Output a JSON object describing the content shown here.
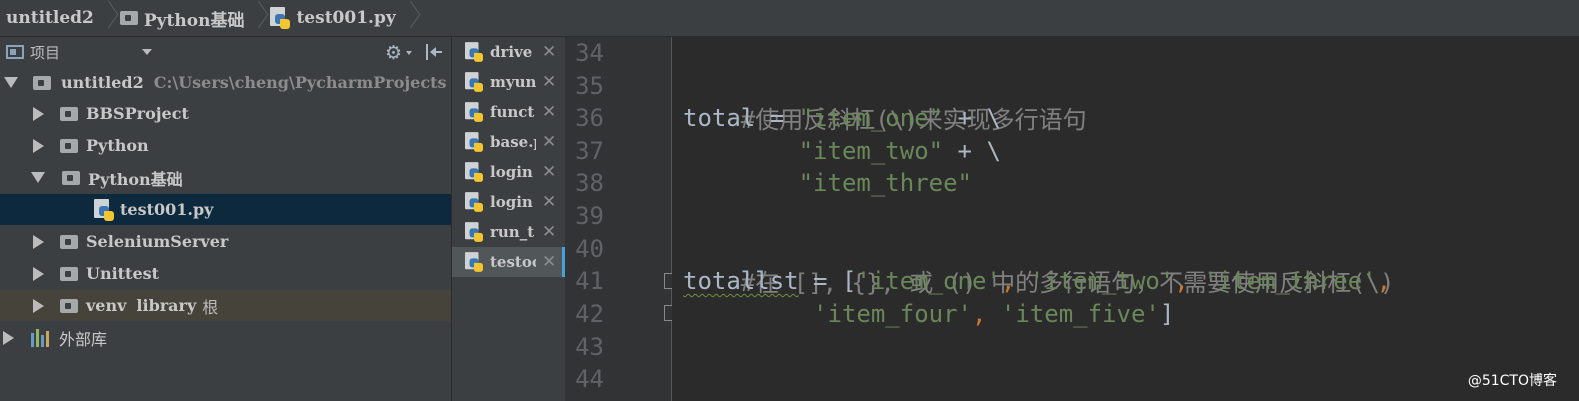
{
  "breadcrumb": {
    "items": [
      {
        "label": "untitled2",
        "icon": "folder-icon"
      },
      {
        "label": "Python基础",
        "icon": "folder-icon"
      },
      {
        "label": "test001.py",
        "icon": "python-file-icon"
      }
    ]
  },
  "project_panel": {
    "title": "项目",
    "tree": [
      {
        "label": "untitled2",
        "path": "C:\\Users\\cheng\\PycharmProjects",
        "expanded": true,
        "icon": "folder-icon"
      },
      {
        "label": "BBSProject",
        "icon": "folder-icon",
        "expanded": false
      },
      {
        "label": "Python",
        "icon": "folder-icon",
        "expanded": false
      },
      {
        "label": "Python基础",
        "icon": "folder-icon",
        "expanded": true
      },
      {
        "label": "test001.py",
        "icon": "python-file-icon",
        "selected": true
      },
      {
        "label": "SeleniumServer",
        "icon": "folder-icon",
        "expanded": false
      },
      {
        "label": "Unittest",
        "icon": "folder-icon",
        "expanded": false
      },
      {
        "label": "venv",
        "library": "library",
        "root": "根",
        "icon": "folder-icon",
        "expanded": false
      },
      {
        "label": "外部库",
        "icon": "library-icon",
        "expanded": false
      }
    ]
  },
  "tabs": [
    {
      "label": "drive",
      "active": false
    },
    {
      "label": "myun",
      "active": false
    },
    {
      "label": "funct",
      "active": false
    },
    {
      "label": "base.p",
      "active": false
    },
    {
      "label": "login",
      "active": false
    },
    {
      "label": "login",
      "active": false
    },
    {
      "label": "run_t",
      "active": false
    },
    {
      "label": "testoo",
      "active": true
    }
  ],
  "editor": {
    "line_numbers": [
      "34",
      "35",
      "36",
      "37",
      "38",
      "39",
      "40",
      "41",
      "42",
      "43",
      "44"
    ],
    "code": {
      "l35_comment": "#使用反斜杠(\\)来实现多行语句",
      "l36_var": "total = ",
      "l36_str": "\"item_one\"",
      "l36_rest": " + \\",
      "l37_indent": "        ",
      "l37_str": "\"item_two\"",
      "l37_rest": " + \\",
      "l38_indent": "        ",
      "l38_str": "\"item_three\"",
      "l40_comment": "#在 [], {}, 或 () 中的多行语句，不需要使用反斜杠(\\)",
      "l41_var": "totallst",
      "l41_eq": " = [",
      "l41_s1": "'item_one'",
      "l41_c1": ", ",
      "l41_s2": "'item_two'",
      "l41_c2": ", ",
      "l41_s3": "'item_three'",
      "l41_c3": ",",
      "l42_indent": "         ",
      "l42_s1": "'item_four'",
      "l42_c1": ", ",
      "l42_s2": "'item_five'",
      "l42_end": "]"
    }
  },
  "watermark": "@51CTO博客",
  "colors": {
    "background": "#2b2b2b",
    "panel": "#3c3f41",
    "selection": "#0d293e",
    "comment": "#808080",
    "string": "#6a8759",
    "keyword": "#cc7832",
    "text": "#a9b7c6"
  }
}
